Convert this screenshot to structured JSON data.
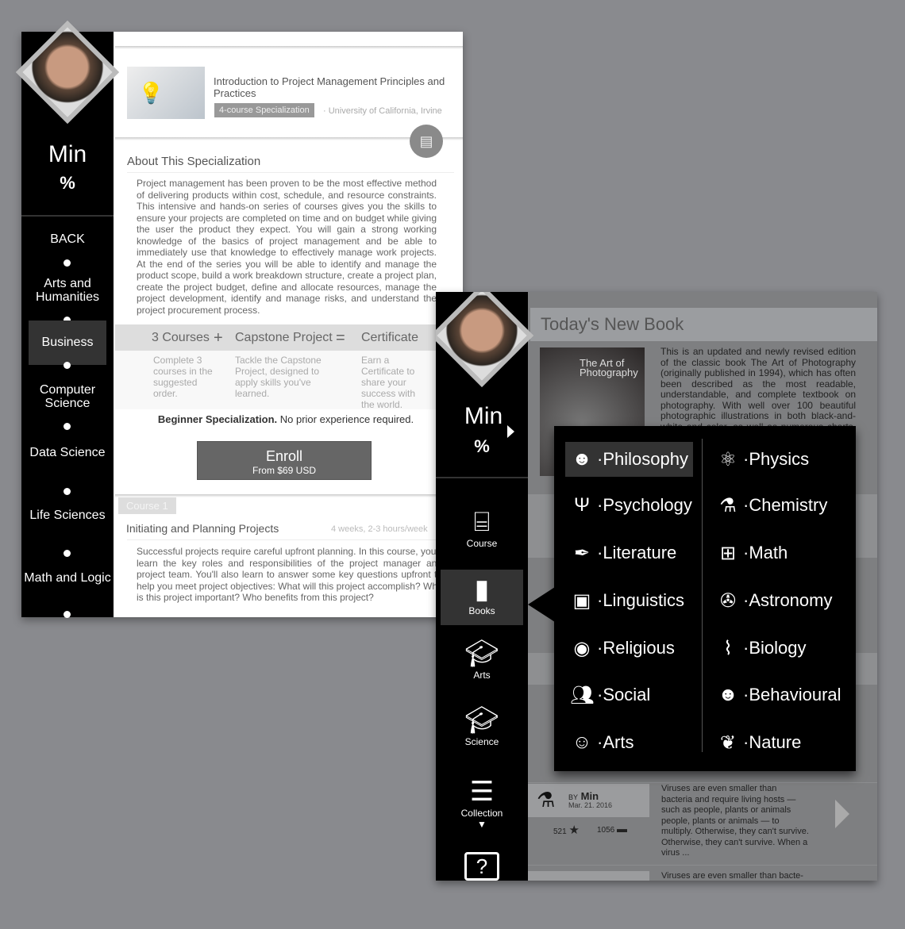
{
  "left_screen": {
    "user": {
      "name": "Min",
      "icon": "percent-badge-icon"
    },
    "nav": [
      "BACK",
      "Arts and Humanities",
      "Business",
      "Computer Science",
      "Data Science",
      "Life Sciences",
      "Math and Logic"
    ],
    "nav_active": "Business",
    "course": {
      "title": "Introduction to Project Management Principles and Practices",
      "badge": "4-course Specialization",
      "university": "· University of California, Irvine"
    },
    "about": {
      "heading": "About This Specialization",
      "text": "Project management has been proven to be the most effective method of delivering products within cost, schedule, and resource constraints. This intensive and hands-on series of courses gives you the skills to ensure your projects are completed on time and on budget while giving the user the product they expect. You will gain a strong working knowledge of the basics of project management and be able to immediately use that knowledge to effectively manage work projects. At the end of the series you will be able to identify and manage the product scope, build a work breakdown structure, create a project plan, create the project budget, define and allocate resources, manage the project development, identify and manage risks, and understand the project procurement process."
    },
    "formula": {
      "a": "3 Courses",
      "plus": "+",
      "b": "Capstone Project",
      "eq": "=",
      "c": "Certificate",
      "a_desc": "Complete 3 courses in the suggested order.",
      "b_desc": "Tackle the Capstone Project, designed to apply skills you've learned.",
      "c_desc": "Earn a Certificate to share your success with the world."
    },
    "level_bold": "Beginner Specialization.",
    "level_rest": " No prior experience required.",
    "enroll": {
      "label": "Enroll",
      "price": "From $69 USD"
    },
    "course1": {
      "tag": "Course 1",
      "title": "Initiating and Planning Projects",
      "duration": "4 weeks, 2-3 hours/week",
      "text": "Successful projects require careful upfront planning. In this course, you'll learn the key roles and responsibilities of the project manager and project team. You'll also learn to answer some key questions upfront to help you meet project objectives: What will this project accomplish? Why is this project important? Who benefits from this project?"
    }
  },
  "right_screen": {
    "user": {
      "name": "Min"
    },
    "sidebar": [
      {
        "label": "Course",
        "icon": "presentation-icon"
      },
      {
        "label": "Books",
        "icon": "book-icon"
      },
      {
        "label": "Arts",
        "icon": "graduation-cap-icon"
      },
      {
        "label": "Science",
        "icon": "graduation-cap-icon"
      },
      {
        "label": "Collection",
        "icon": "collection-icon"
      },
      {
        "label": "",
        "icon": "help-icon"
      }
    ],
    "sidebar_active": "Books",
    "header": "Today's New Book",
    "book": {
      "cover_title": "The Art of Photography",
      "text": "This is an updated and newly revised edition of the classic book The Art of Photography (originally published in 1994), which has often been described as the most readable, understandable, and complete textbook on photography. With well over 100 beautiful photographic illustrations in both black-and-white and color, as well as numerous charts, graphs, and tables, this book pro-"
    },
    "menu_left": [
      {
        "label": "·Philosophy",
        "icon": "head-icon",
        "active": true
      },
      {
        "label": "·Psychology",
        "icon": "psi-icon"
      },
      {
        "label": "·Literature",
        "icon": "pen-icon"
      },
      {
        "label": "·Linguistics",
        "icon": "speech-icon"
      },
      {
        "label": "·Religious",
        "icon": "ring-icon"
      },
      {
        "label": "·Social",
        "icon": "people-icon"
      },
      {
        "label": "·Arts",
        "icon": "face-icon"
      }
    ],
    "menu_right": [
      {
        "label": "·Physics",
        "icon": "atom-icon"
      },
      {
        "label": "·Chemistry",
        "icon": "flask-icon"
      },
      {
        "label": "·Math",
        "icon": "calculator-icon"
      },
      {
        "label": "·Astronomy",
        "icon": "telescope-icon"
      },
      {
        "label": "·Biology",
        "icon": "dna-icon"
      },
      {
        "label": "·Behavioural",
        "icon": "head-gear-icon"
      },
      {
        "label": "·Nature",
        "icon": "leaf-icon"
      }
    ],
    "post": {
      "by": "BY",
      "author": "Min",
      "date": "Mar. 21. 2016",
      "stars": "521",
      "saves": "1056",
      "text": "Viruses are even smaller than bacteria and require living hosts — such as people, plants or animals  people, plants or animals — to multiply. Otherwise, they can't survive. Otherwise, they can't survive. When a virus ...",
      "next_text": "Viruses are even smaller than bacte-"
    }
  }
}
